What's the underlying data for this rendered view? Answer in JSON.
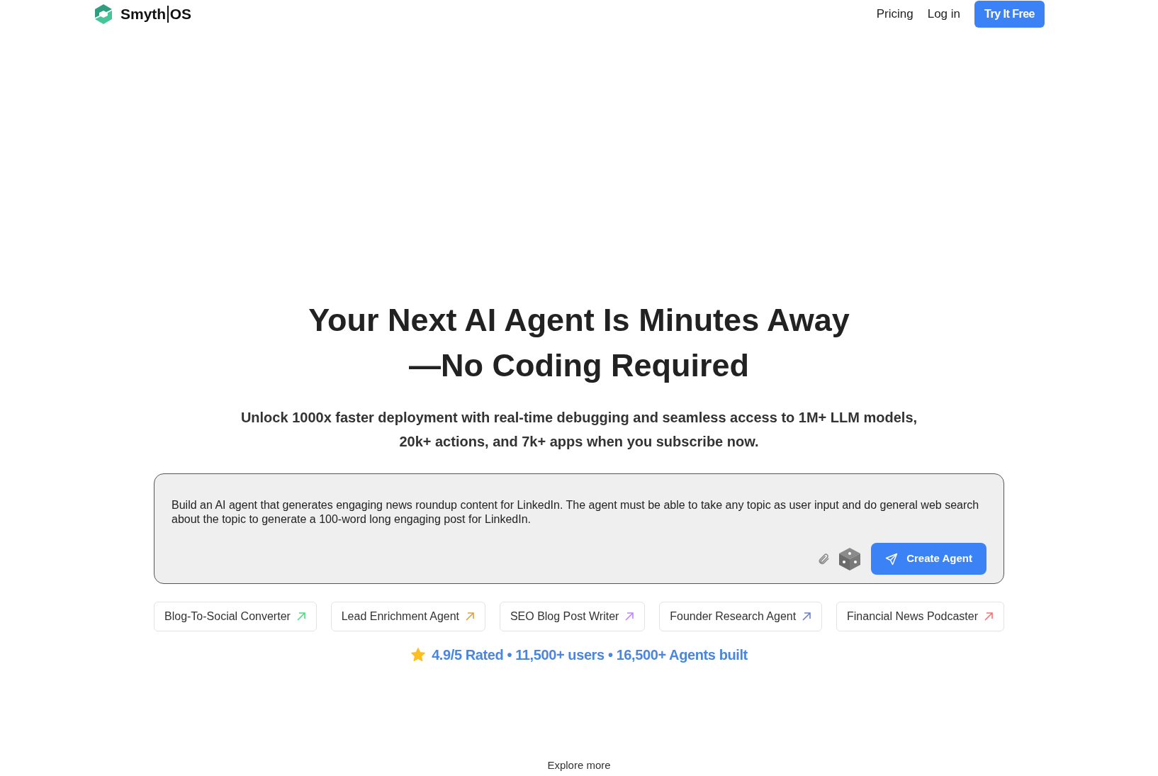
{
  "header": {
    "logo_parts": [
      "Smyth",
      "OS"
    ],
    "nav": [
      "Pricing",
      "Log in"
    ],
    "cta": "Try It Free"
  },
  "hero": {
    "title_lines": [
      "Your Next AI Agent Is Minutes Away",
      "—No Coding Required"
    ],
    "subtitle_lines": [
      "Unlock 1000x faster deployment with real-time debugging and seamless access to 1M+ LLM models,",
      "20k+ actions, and 7k+ apps when you subscribe now."
    ]
  },
  "prompt": {
    "value": "Build an AI agent that generates engaging news roundup content for LinkedIn. The agent must be able to take any topic as user input and do general web search about the topic to generate a 100-word long engaging post for LinkedIn.",
    "button": "Create Agent"
  },
  "templates": [
    {
      "label": "Blog-To-Social Converter",
      "color": "#4ade80"
    },
    {
      "label": "Lead Enrichment Agent",
      "color": "#e0a040"
    },
    {
      "label": "SEO Blog Post Writer",
      "color": "#c084fc"
    },
    {
      "label": "Founder Research Agent",
      "color": "#6b7fd0"
    },
    {
      "label": "Financial News Podcaster",
      "color": "#f87171"
    }
  ],
  "stats": "4.9/5 Rated • 11,500+ users • 16,500+ Agents built",
  "explore": "Explore more"
}
